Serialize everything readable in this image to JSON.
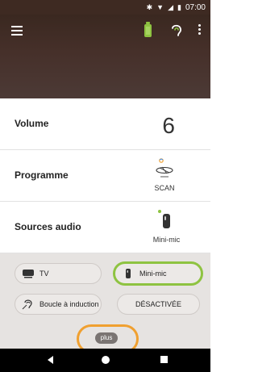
{
  "status_bar": {
    "icons": [
      "bluetooth-icon",
      "wifi-icon",
      "signal-icon",
      "battery-icon"
    ],
    "time": "07:00"
  },
  "toolbar": {
    "menu_icon": "hamburger-menu-icon",
    "battery_icon": "hearing-aid-battery-icon",
    "ear_icon": "hearing-aid-ear-icon",
    "more_icon": "more-vert-icon",
    "battery_color": "#8ec341"
  },
  "settings": {
    "volume": {
      "label": "Volume",
      "value": "6"
    },
    "program": {
      "label": "Programme",
      "value": "SCAN",
      "icon": "scan-program-icon"
    },
    "audio_sources": {
      "label": "Sources audio",
      "value": "Mini-mic",
      "icon": "mini-mic-icon"
    }
  },
  "sources": {
    "options": [
      {
        "label": "TV",
        "icon": "tv-icon",
        "selected": false
      },
      {
        "label": "Mini-mic",
        "icon": "mini-mic-icon",
        "selected": true
      },
      {
        "label": "Boucle à induction",
        "icon": "induction-loop-icon",
        "selected": false
      },
      {
        "label": "DÉSACTIVÉE",
        "icon": "",
        "selected": false
      }
    ],
    "more_label": "plus",
    "selected_color": "#8ec341",
    "highlight_color": "#f0a030"
  },
  "navbar": {
    "back_icon": "back-icon",
    "home_icon": "home-icon",
    "recent_icon": "recent-apps-icon"
  }
}
